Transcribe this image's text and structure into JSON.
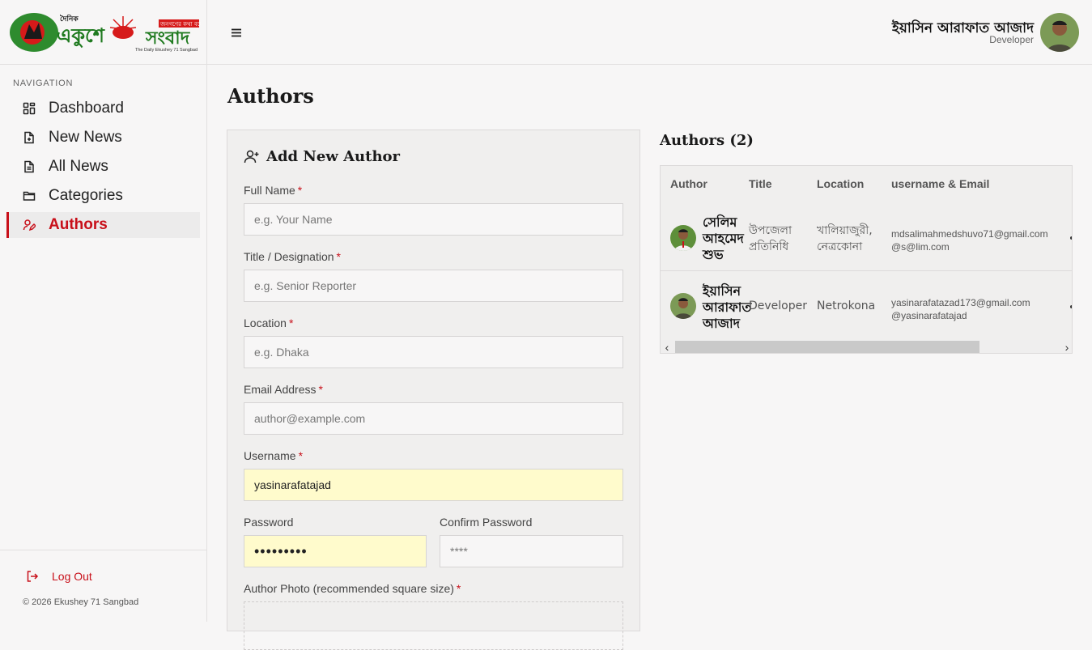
{
  "brand": {
    "logo_small": "দৈনিক",
    "logo_main_left": "একুশে",
    "logo_main_right": "সংবাদ",
    "logo_tagline": "জনগণের কথা বলে",
    "logo_sub": "The Daily Ekushey 71 Sangbad"
  },
  "sidebar": {
    "heading": "NAVIGATION",
    "items": [
      {
        "label": "Dashboard",
        "icon": "dashboard-icon"
      },
      {
        "label": "New News",
        "icon": "file-plus-icon"
      },
      {
        "label": "All News",
        "icon": "file-text-icon"
      },
      {
        "label": "Categories",
        "icon": "folder-icon"
      },
      {
        "label": "Authors",
        "icon": "user-pen-icon",
        "active": true
      }
    ],
    "logout_label": "Log Out",
    "copyright": "© 2026 Ekushey 71 Sangbad"
  },
  "header": {
    "user_name": "ইয়াসিন আরাফাত আজাদ",
    "user_role": "Developer"
  },
  "page": {
    "title": "Authors"
  },
  "form": {
    "title": "Add New Author",
    "fields": {
      "full_name": {
        "label": "Full Name",
        "placeholder": "e.g. Your Name"
      },
      "title": {
        "label": "Title / Designation",
        "placeholder": "e.g. Senior Reporter"
      },
      "location": {
        "label": "Location",
        "placeholder": "e.g. Dhaka"
      },
      "email": {
        "label": "Email Address",
        "placeholder": "author@example.com"
      },
      "username": {
        "label": "Username",
        "value": "yasinarafatajad"
      },
      "password": {
        "label": "Password",
        "value": "•••••••••"
      },
      "confirm_password": {
        "label": "Confirm Password",
        "placeholder": "****"
      },
      "photo": {
        "label": "Author Photo (recommended square size)"
      }
    },
    "required_mark": "*"
  },
  "authors": {
    "title": "Authors (2)",
    "columns": [
      "Author",
      "Title",
      "Location",
      "username & Email"
    ],
    "rows": [
      {
        "name": "সেলিম আহমেদ শুভ",
        "title": "উপজেলা প্রতিনিধি",
        "location": "খালিয়াজুরী, নেত্রকোনা",
        "email": "mdsalimahmedshuvo71@gmail.com",
        "username": "@s@lim.com"
      },
      {
        "name": "ইয়াসিন আরাফাত আজাদ",
        "title": "Developer",
        "location": "Netrokona",
        "email": "yasinarafatazad173@gmail.com",
        "username": "@yasinarafatajad"
      }
    ]
  },
  "colors": {
    "accent": "#c8101a",
    "autofill": "#fffbcc",
    "background": "#f7f6f6",
    "card": "#f0efee"
  }
}
